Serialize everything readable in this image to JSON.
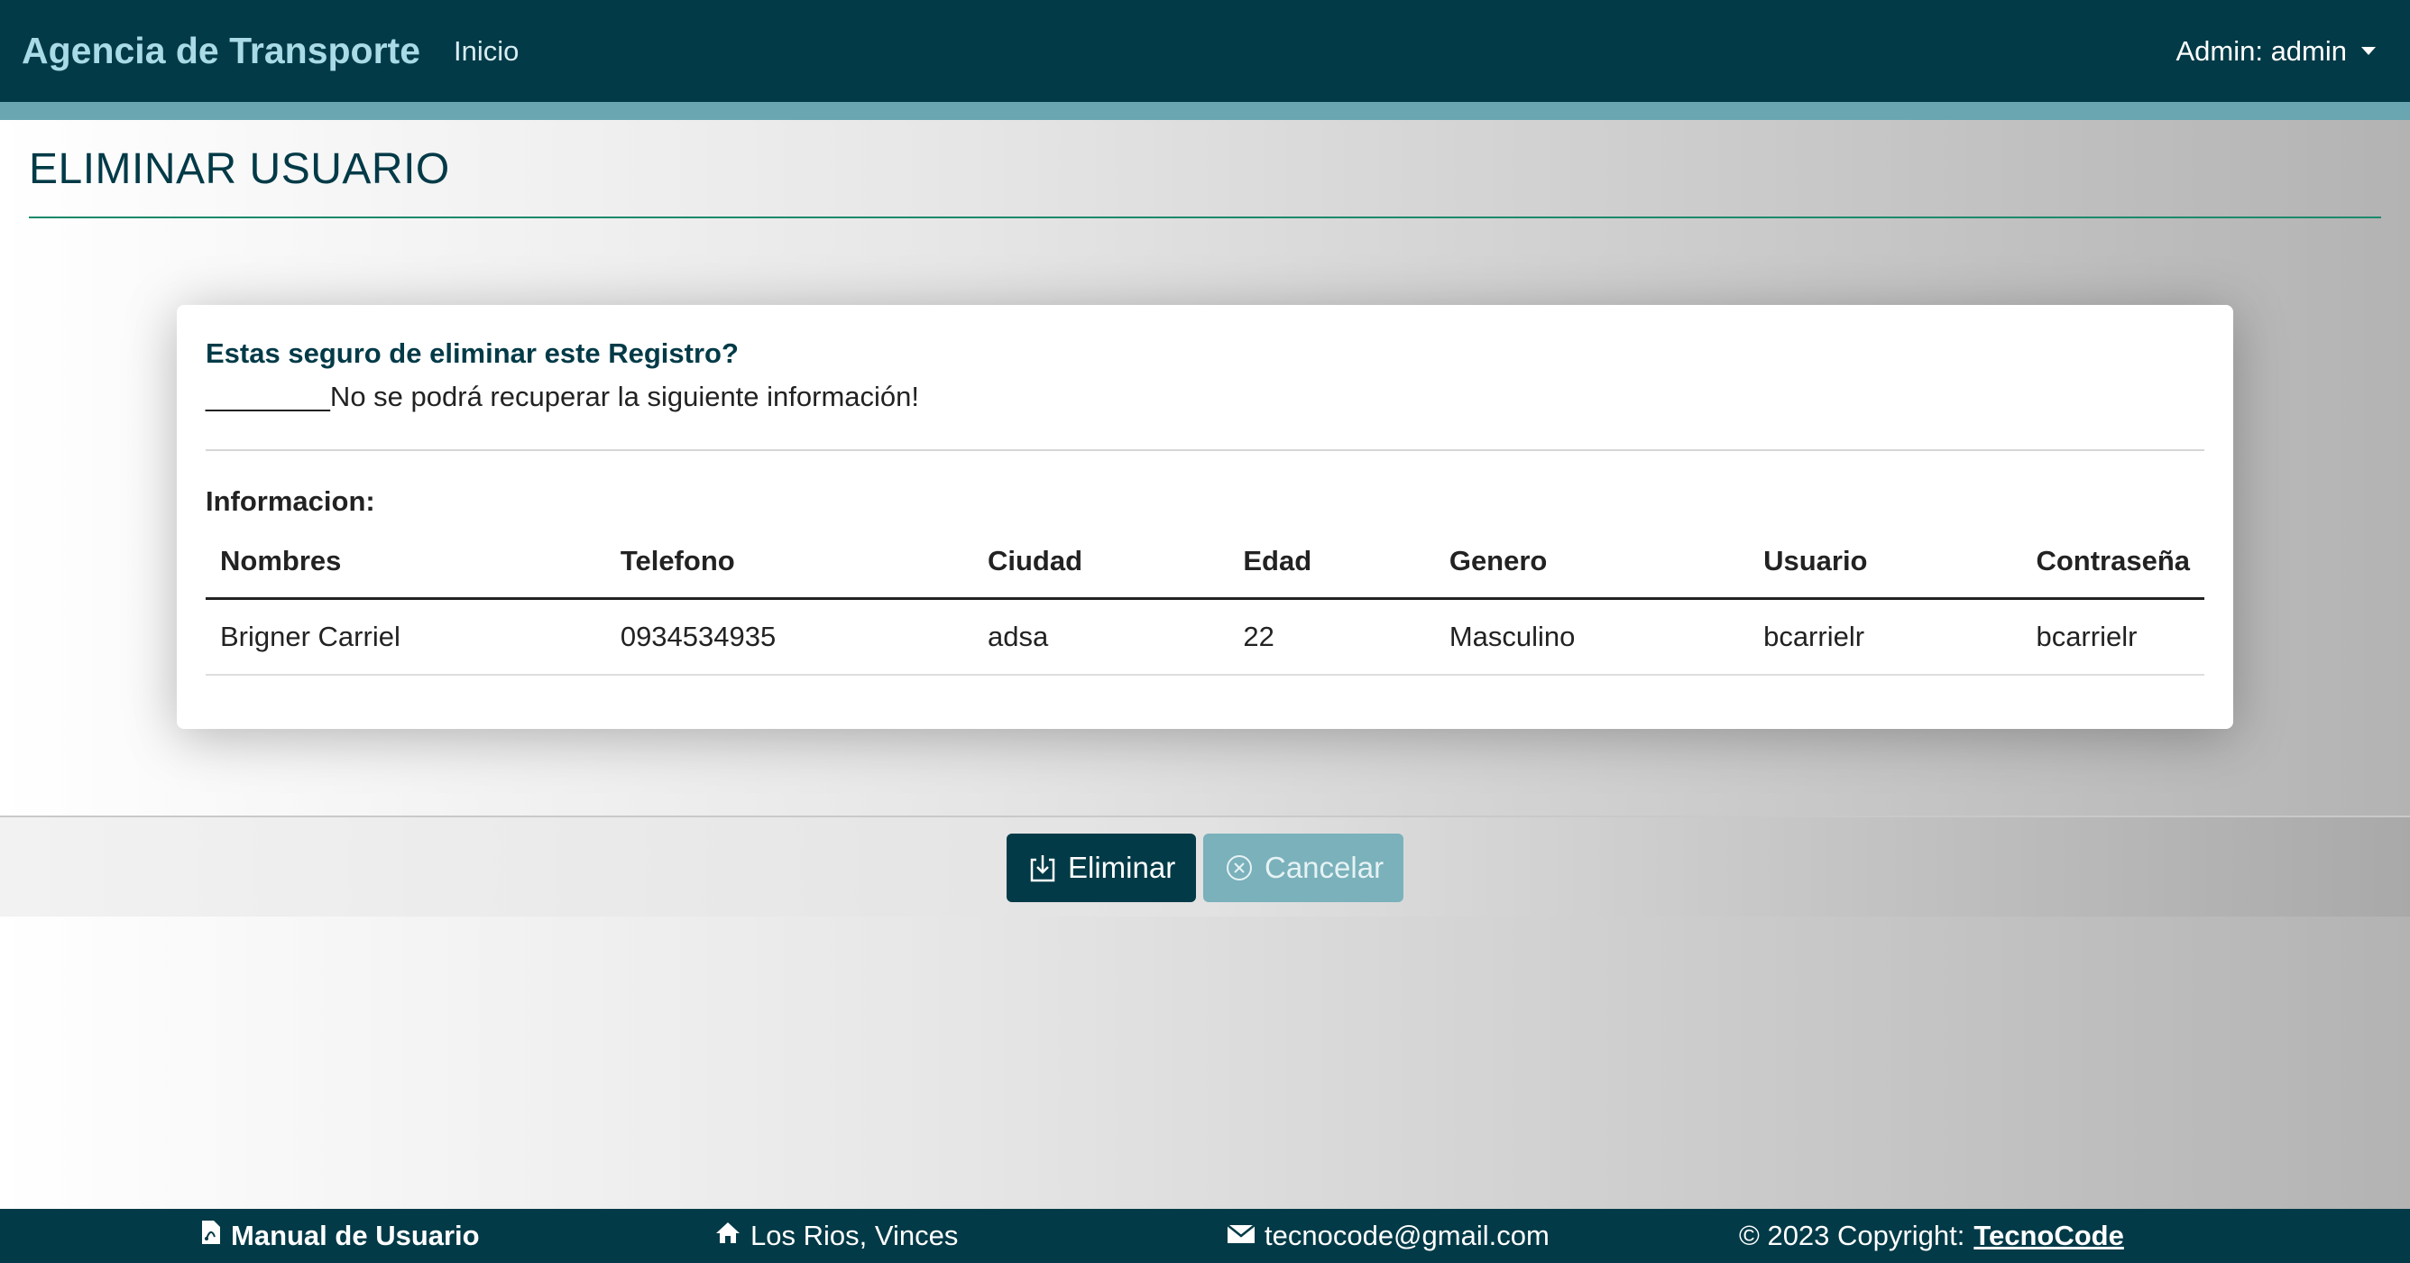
{
  "navbar": {
    "brand": "Agencia de Transporte",
    "home_link": "Inicio",
    "user_menu": "Admin: admin"
  },
  "page": {
    "title": "ELIMINAR USUARIO"
  },
  "card": {
    "question": "Estas seguro de eliminar este Registro?",
    "warning": "________No se podrá recuperar la siguiente información!",
    "info_label": "Informacion:",
    "table": {
      "headers": [
        "Nombres",
        "Telefono",
        "Ciudad",
        "Edad",
        "Genero",
        "Usuario",
        "Contraseña"
      ],
      "rows": [
        [
          "Brigner Carriel",
          "0934534935",
          "adsa",
          "22",
          "Masculino",
          "bcarrielr",
          "bcarrielr"
        ]
      ]
    }
  },
  "actions": {
    "delete_label": "Eliminar",
    "cancel_label": "Cancelar"
  },
  "footer": {
    "manual": "Manual de Usuario",
    "location": "Los Rios, Vinces",
    "email": "tecnocode@gmail.com",
    "copyright": "© 2023 Copyright:",
    "company": "TecnoCode"
  },
  "icons": {
    "manual": "pdf-file-icon",
    "location": "house-icon",
    "email": "envelope-icon",
    "delete": "download-box-icon",
    "cancel": "x-circle-icon",
    "user_menu": "caret-down-icon"
  },
  "colors": {
    "primary": "#023a47",
    "accent": "#6aa6b1",
    "cancel_button": "#7ab1bb",
    "title_rule": "#1b8a6b"
  }
}
